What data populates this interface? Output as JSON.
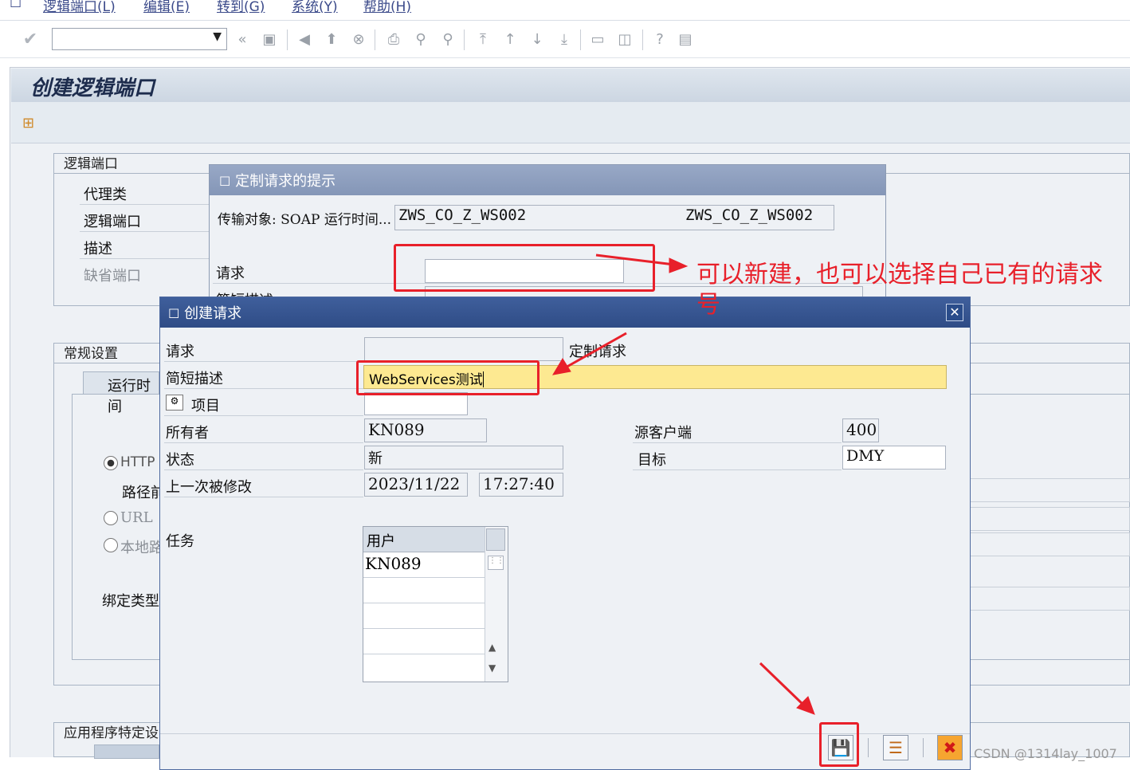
{
  "menu": {
    "items": [
      "逻辑端口(L)",
      "编辑(E)",
      "转到(G)",
      "系统(Y)",
      "帮助(H)"
    ]
  },
  "page": {
    "title": "创建逻辑端口"
  },
  "logical_port_group": {
    "title": "逻辑端口",
    "labels": [
      "代理类",
      "逻辑端口",
      "描述",
      "缺省端口"
    ]
  },
  "general_group": {
    "title": "常规设置",
    "tab": "运行时间",
    "radio_http": "HTTP",
    "path_label": "路径前",
    "radio_url": "URL",
    "radio_local": "本地路",
    "binding_label": "绑定类型"
  },
  "app_group": {
    "title": "应用程序特定设"
  },
  "prompt_dialog": {
    "title": "定制请求的提示",
    "transport_label": "传输对象: SOAP 运行时间...",
    "transport_value1": "ZWS_CO_Z_WS002",
    "transport_value2": "ZWS_CO_Z_WS002",
    "request_label": "请求",
    "short_desc_label": "简短描述"
  },
  "create_dialog": {
    "title": "创建请求",
    "close": "✕",
    "request_label": "请求",
    "request_type": "定制请求",
    "short_desc_label": "简短描述",
    "short_desc_value": "WebServices测试",
    "project_label": "项目",
    "owner_label": "所有者",
    "owner_value": "KN089",
    "status_label": "状态",
    "status_value": "新",
    "modified_label": "上一次被修改",
    "modified_date": "2023/11/22",
    "modified_time": "17:27:40",
    "source_client_label": "源客户端",
    "source_client_value": "400",
    "target_label": "目标",
    "target_value": "DMY",
    "tasks_label": "任务",
    "tasks_table": {
      "header": "用户",
      "rows": [
        "KN089",
        "",
        "",
        "",
        ""
      ]
    }
  },
  "annotation": {
    "note": "可以新建，也可以选择自己已有的请求号"
  },
  "watermark": "CSDN @1314lay_1007",
  "colors": {
    "annotation_red": "#e8202a",
    "highlight_yellow": "#fde991",
    "dialog_header": "#2f4c86"
  }
}
